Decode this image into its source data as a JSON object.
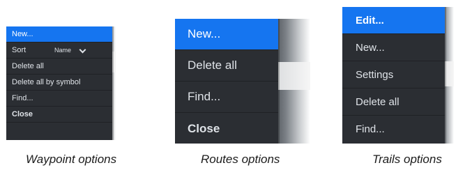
{
  "waypoint_menu": {
    "items": [
      "New...",
      "Delete all",
      "Delete all by symbol",
      "Find...",
      "Close"
    ],
    "sort_label": "Sort",
    "sort_value": "Name",
    "caption": "Waypoint options"
  },
  "routes_menu": {
    "items": [
      "New...",
      "Delete all",
      "Find...",
      "Close"
    ],
    "caption": "Routes options"
  },
  "trails_menu": {
    "items": [
      "Edit...",
      "New...",
      "Settings",
      "Delete all",
      "Find..."
    ],
    "caption": "Trails options"
  },
  "colors": {
    "selected": "#1575f0",
    "menu_bg": "#2b2e33",
    "menu_text": "#dfe3e8"
  }
}
